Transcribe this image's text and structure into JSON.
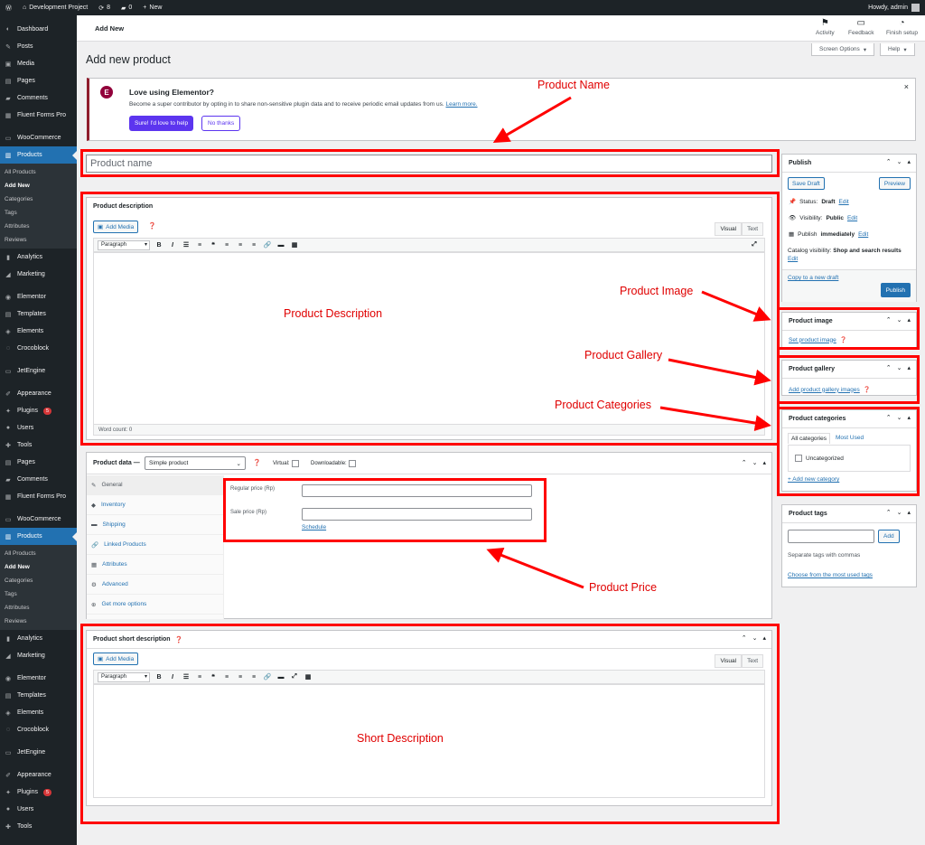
{
  "admin_bar": {
    "site_name": "Development Project",
    "updates_count": "8",
    "comments_count": "0",
    "new_label": "New",
    "howdy": "Howdy, admin"
  },
  "sidebar": {
    "group1": [
      {
        "label": "Dashboard",
        "icon": "dashboard-icon"
      },
      {
        "label": "Posts",
        "icon": "pin-icon"
      },
      {
        "label": "Media",
        "icon": "media-icon"
      },
      {
        "label": "Pages",
        "icon": "page-icon"
      },
      {
        "label": "Comments",
        "icon": "comment-icon"
      },
      {
        "label": "Fluent Forms Pro",
        "icon": "form-icon"
      },
      {
        "label": "WooCommerce",
        "icon": "woo-icon"
      },
      {
        "label": "Products",
        "icon": "products-icon"
      }
    ],
    "products_submenu": [
      "All Products",
      "Add New",
      "Categories",
      "Tags",
      "Attributes",
      "Reviews"
    ],
    "group2": [
      {
        "label": "Analytics",
        "icon": "analytics-icon"
      },
      {
        "label": "Marketing",
        "icon": "megaphone-icon"
      },
      {
        "label": "Elementor",
        "icon": "elementor-icon"
      },
      {
        "label": "Templates",
        "icon": "folder-icon"
      },
      {
        "label": "Elements",
        "icon": "elements-icon"
      },
      {
        "label": "Crocoblock",
        "icon": "crocoblock-icon"
      },
      {
        "label": "JetEngine",
        "icon": "jetengine-icon"
      },
      {
        "label": "Appearance",
        "icon": "brush-icon"
      },
      {
        "label": "Plugins",
        "icon": "plugin-icon",
        "badge": "5"
      },
      {
        "label": "Users",
        "icon": "user-icon"
      },
      {
        "label": "Tools",
        "icon": "wrench-icon"
      }
    ],
    "group3": [
      {
        "label": "Pages",
        "icon": "page-icon"
      },
      {
        "label": "Comments",
        "icon": "comment-icon"
      },
      {
        "label": "Fluent Forms Pro",
        "icon": "form-icon"
      },
      {
        "label": "WooCommerce",
        "icon": "woo-icon"
      },
      {
        "label": "Products",
        "icon": "products-icon"
      }
    ],
    "group4": [
      {
        "label": "Analytics",
        "icon": "analytics-icon"
      },
      {
        "label": "Marketing",
        "icon": "megaphone-icon"
      },
      {
        "label": "Elementor",
        "icon": "elementor-icon"
      },
      {
        "label": "Templates",
        "icon": "folder-icon"
      },
      {
        "label": "Elements",
        "icon": "elements-icon"
      },
      {
        "label": "Crocoblock",
        "icon": "crocoblock-icon"
      },
      {
        "label": "JetEngine",
        "icon": "jetengine-icon"
      },
      {
        "label": "Appearance",
        "icon": "brush-icon"
      },
      {
        "label": "Plugins",
        "icon": "plugin-icon",
        "badge": "5"
      },
      {
        "label": "Users",
        "icon": "user-icon"
      },
      {
        "label": "Tools",
        "icon": "wrench-icon"
      }
    ]
  },
  "top": {
    "breadcrumb": "Add New",
    "activity": "Activity",
    "feedback": "Feedback",
    "finish_setup": "Finish setup",
    "screen_options": "Screen Options",
    "help": "Help"
  },
  "page_title": "Add new product",
  "notice": {
    "title": "Love using Elementor?",
    "text": "Become a super contributor by opting in to share non-sensitive plugin data and to receive periodic email updates from us.",
    "learn_more": "Learn more.",
    "accept": "Sure! I'd love to help",
    "decline": "No thanks"
  },
  "product_name_placeholder": "Product name",
  "description": {
    "title": "Product description",
    "add_media": "Add Media",
    "tab_visual": "Visual",
    "tab_text": "Text",
    "format": "Paragraph",
    "word_count": "Word count: 0"
  },
  "product_data": {
    "title": "Product data —",
    "type": "Simple product",
    "virtual": "Virtual:",
    "downloadable": "Downloadable:",
    "tabs": [
      "General",
      "Inventory",
      "Shipping",
      "Linked Products",
      "Attributes",
      "Advanced",
      "Get more options"
    ],
    "regular_price_label": "Regular price (Rp)",
    "sale_price_label": "Sale price (Rp)",
    "schedule": "Schedule"
  },
  "short_description": {
    "title": "Product short description",
    "add_media": "Add Media",
    "tab_visual": "Visual",
    "tab_text": "Text",
    "format": "Paragraph"
  },
  "publish": {
    "title": "Publish",
    "save_draft": "Save Draft",
    "preview": "Preview",
    "status": "Status:",
    "status_value": "Draft",
    "visibility": "Visibility:",
    "visibility_value": "Public",
    "publish_label": "Publish",
    "publish_value": "immediately",
    "edit": "Edit",
    "catalog_visibility": "Catalog visibility:",
    "catalog_value": "Shop and search results",
    "copy_draft": "Copy to a new draft",
    "publish_button": "Publish"
  },
  "product_image": {
    "title": "Product image",
    "link": "Set product image"
  },
  "product_gallery": {
    "title": "Product gallery",
    "link": "Add product gallery images"
  },
  "product_categories": {
    "title": "Product categories",
    "tab_all": "All categories",
    "tab_used": "Most Used",
    "item": "Uncategorized",
    "add_new": "+ Add new category"
  },
  "product_tags": {
    "title": "Product tags",
    "add": "Add",
    "hint": "Separate tags with commas",
    "choose": "Choose from the most used tags"
  },
  "annotations": {
    "product_name": "Product Name",
    "product_description": "Product Description",
    "product_image": "Product Image",
    "product_gallery": "Product Gallery",
    "product_categories": "Product Categories",
    "product_price": "Product Price",
    "short_description": "Short Description"
  },
  "colors": {
    "annotation_red": "#ff0000",
    "admin_dark": "#1d2327",
    "wp_blue": "#2271b1",
    "elementor_purple": "#5c35ef"
  }
}
